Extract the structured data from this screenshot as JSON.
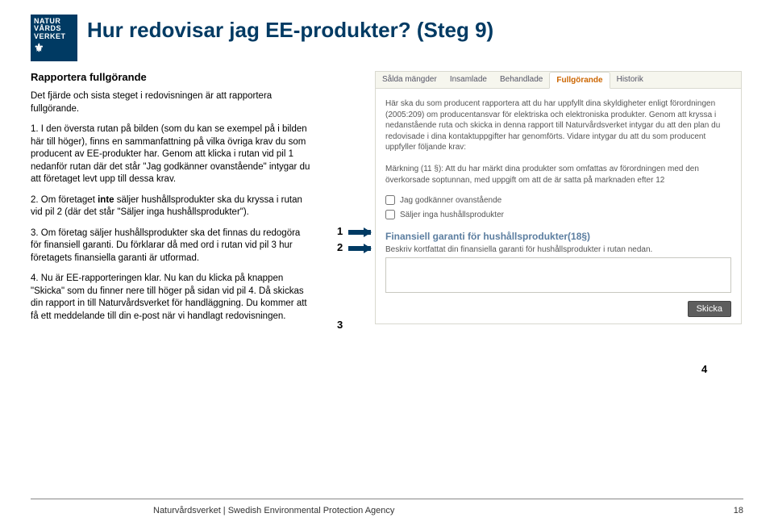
{
  "logo": {
    "line1": "NATUR",
    "line2": "VÅRDS",
    "line3": "VERKET"
  },
  "title": "Hur redovisar jag EE-produkter? (Steg 9)",
  "subtitle": "Rapportera fullgörande",
  "paragraphs": {
    "p0": "Det fjärde och sista steget i redovisningen är att rapportera fullgörande.",
    "p1": "1. I den översta rutan på bilden (som du kan se exempel på i bilden här till höger), finns en sammanfattning på vilka övriga krav du som producent av EE-produkter har. Genom att klicka i rutan vid pil 1 nedanför rutan där det står \"Jag godkänner ovanstående\" intygar du att företaget levt upp till dessa krav.",
    "p2a": "2. Om företaget ",
    "p2b": "inte",
    "p2c": " säljer hushållsprodukter ska du kryssa i rutan vid pil 2 (där det står \"Säljer inga hushållsprodukter\").",
    "p3": "3. Om företag säljer hushållsprodukter ska det finnas du redogöra för finansiell garanti. Du förklarar då med ord i rutan vid pil 3 hur företagets finansiella garanti är utformad.",
    "p4": "4. Nu är EE-rapporteringen klar. Nu kan du klicka på knappen \"Skicka\" som du finner nere till höger på sidan vid pil 4. Då skickas din rapport in till Naturvårdsverket för handläggning. Du kommer att få ett meddelande till din e-post när vi handlagt redovisningen."
  },
  "markers": {
    "m1": "1",
    "m2": "2",
    "m3": "3",
    "m4": "4"
  },
  "tabs": {
    "t0": "Sålda mängder",
    "t1": "Insamlade",
    "t2": "Behandlade",
    "t3": "Fullgörande",
    "t4": "Historik"
  },
  "screenshot": {
    "info": "Här ska du som producent rapportera att du har uppfyllt dina skyldigheter enligt förordningen (2005:209) om producentansvar för elektriska och elektroniska produkter. Genom att kryssa i nedanstående ruta och skicka in denna rapport till Naturvårdsverket intygar du att den plan du redovisade i dina kontaktuppgifter har genomförts. Vidare intygar du att du som producent uppfyller följande krav:\n\nMärkning (11 §): Att du har märkt dina produkter som omfattas av förordningen med den överkorsade soptunnan, med uppgift om att de är satta på marknaden efter 12",
    "chk1": "Jag godkänner ovanstående",
    "chk2": "Säljer inga hushållsprodukter",
    "section": "Finansiell garanti för hushållsprodukter(18§)",
    "desc": "Beskriv kortfattat din finansiella garanti för hushållsprodukter i rutan nedan.",
    "submit": "Skicka"
  },
  "footer": {
    "left": "Naturvårdsverket | Swedish Environmental Protection Agency",
    "right": "18"
  }
}
